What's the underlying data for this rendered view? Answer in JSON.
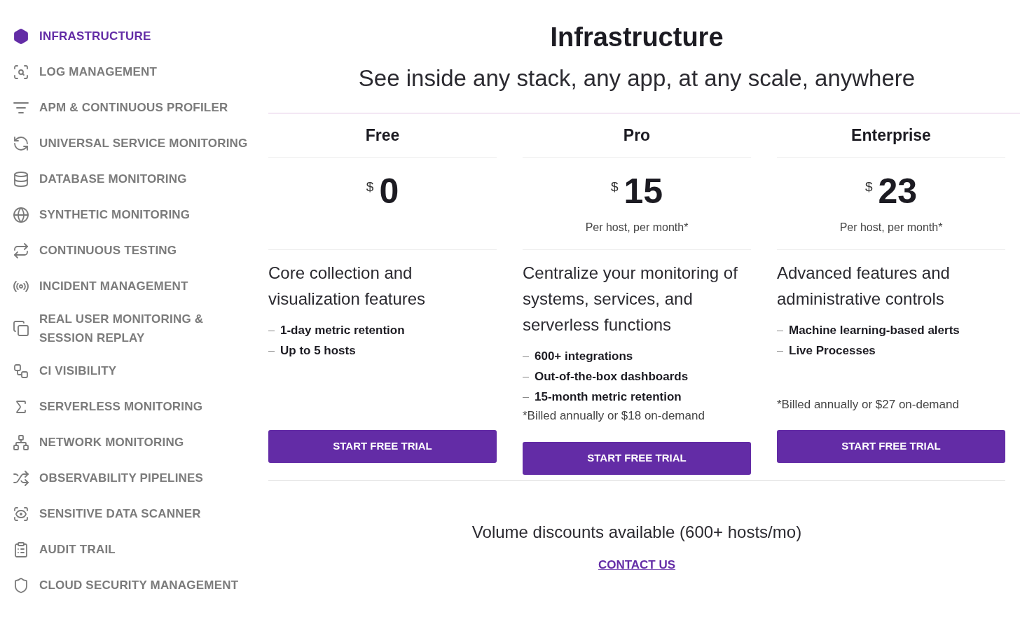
{
  "sidebar": {
    "items": [
      {
        "label": "INFRASTRUCTURE",
        "selected": true
      },
      {
        "label": "LOG MANAGEMENT",
        "selected": false
      },
      {
        "label": "APM & CONTINUOUS PROFILER",
        "selected": false
      },
      {
        "label": "UNIVERSAL SERVICE MONITORING",
        "selected": false
      },
      {
        "label": "DATABASE MONITORING",
        "selected": false
      },
      {
        "label": "SYNTHETIC MONITORING",
        "selected": false
      },
      {
        "label": "CONTINUOUS TESTING",
        "selected": false
      },
      {
        "label": "INCIDENT MANAGEMENT",
        "selected": false
      },
      {
        "label": "REAL USER MONITORING & SESSION REPLAY",
        "selected": false
      },
      {
        "label": "CI VISIBILITY",
        "selected": false
      },
      {
        "label": "SERVERLESS MONITORING",
        "selected": false
      },
      {
        "label": "NETWORK MONITORING",
        "selected": false
      },
      {
        "label": "OBSERVABILITY PIPELINES",
        "selected": false
      },
      {
        "label": "SENSITIVE DATA SCANNER",
        "selected": false
      },
      {
        "label": "AUDIT TRAIL",
        "selected": false
      },
      {
        "label": "CLOUD SECURITY MANAGEMENT",
        "selected": false
      }
    ]
  },
  "header": {
    "title": "Infrastructure",
    "subtitle": "See inside any stack, any app, at any scale, anywhere"
  },
  "plans": [
    {
      "name": "Free",
      "currency": "$",
      "price": "0",
      "description": "Core collection and visualization features",
      "features": [
        "1-day metric retention",
        "Up to 5 hosts"
      ],
      "button": "START FREE TRIAL"
    },
    {
      "name": "Pro",
      "currency": "$",
      "price": "15",
      "price_note": "Per host, per month*",
      "description": "Centralize your monitoring of systems, services, and serverless functions",
      "features": [
        "600+ integrations",
        "Out-of-the-box dashboards",
        "15-month metric retention"
      ],
      "billing_note": "*Billed annually or $18 on-demand",
      "button": "START FREE TRIAL"
    },
    {
      "name": "Enterprise",
      "currency": "$",
      "price": "23",
      "price_note": "Per host, per month*",
      "description": "Advanced features and administrative controls",
      "features": [
        "Machine learning-based alerts",
        "Live Processes"
      ],
      "billing_note": "*Billed annually or $27 on-demand",
      "button": "START FREE TRIAL"
    }
  ],
  "footer": {
    "text": "Volume discounts available (600+ hosts/mo)",
    "link": "CONTACT US"
  }
}
